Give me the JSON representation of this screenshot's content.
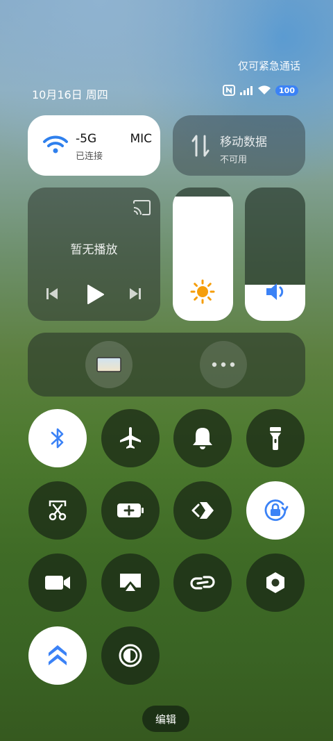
{
  "status": {
    "emergency_only": "仅可紧急通话",
    "date": "10月16日 周四",
    "battery": "100"
  },
  "wifi": {
    "name": "-5G",
    "name_suffix": "MIC",
    "status": "已连接"
  },
  "mobile_data": {
    "title": "移动数据",
    "status": "不可用"
  },
  "media": {
    "status": "暂无播放"
  },
  "brightness": {
    "level": 0.93
  },
  "volume": {
    "level": 0.27
  },
  "edit_label": "编辑",
  "colors": {
    "accent": "#3b82f6",
    "brightness_icon": "#f59e0b"
  },
  "toggles": [
    {
      "icon": "bluetooth-icon",
      "on": true
    },
    {
      "icon": "airplane-icon",
      "on": false
    },
    {
      "icon": "bell-icon",
      "on": false
    },
    {
      "icon": "flashlight-icon",
      "on": false
    },
    {
      "icon": "screenshot-icon",
      "on": false
    },
    {
      "icon": "battery-saver-icon",
      "on": false
    },
    {
      "icon": "share-icon",
      "on": false
    },
    {
      "icon": "rotation-lock-icon",
      "on": true
    },
    {
      "icon": "video-camera-icon",
      "on": false
    },
    {
      "icon": "cast-screen-icon",
      "on": false
    },
    {
      "icon": "link-icon",
      "on": false
    },
    {
      "icon": "nut-settings-icon",
      "on": false
    },
    {
      "icon": "speed-boost-icon",
      "on": true
    },
    {
      "icon": "contrast-icon",
      "on": false
    }
  ]
}
